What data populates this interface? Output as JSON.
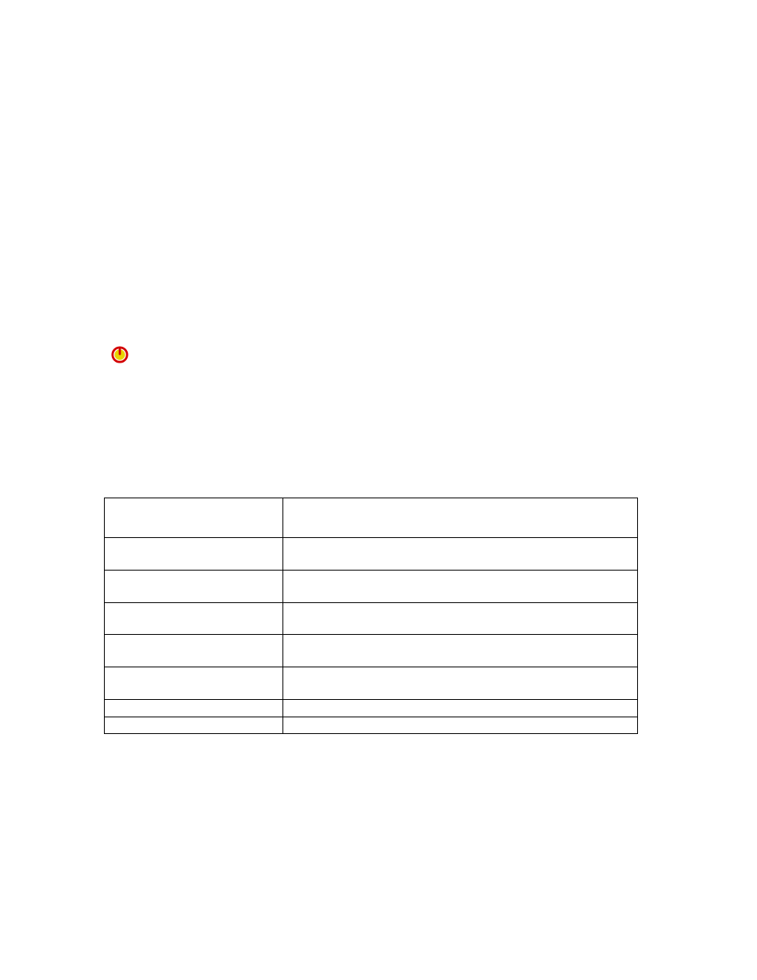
{
  "icon": {
    "name": "power-icon"
  },
  "table": {
    "columns": [
      "",
      ""
    ],
    "rows": [
      [
        "",
        ""
      ],
      [
        "",
        ""
      ],
      [
        "",
        ""
      ],
      [
        "",
        ""
      ],
      [
        "",
        ""
      ],
      [
        "",
        ""
      ],
      [
        "",
        ""
      ],
      [
        "",
        ""
      ]
    ]
  }
}
